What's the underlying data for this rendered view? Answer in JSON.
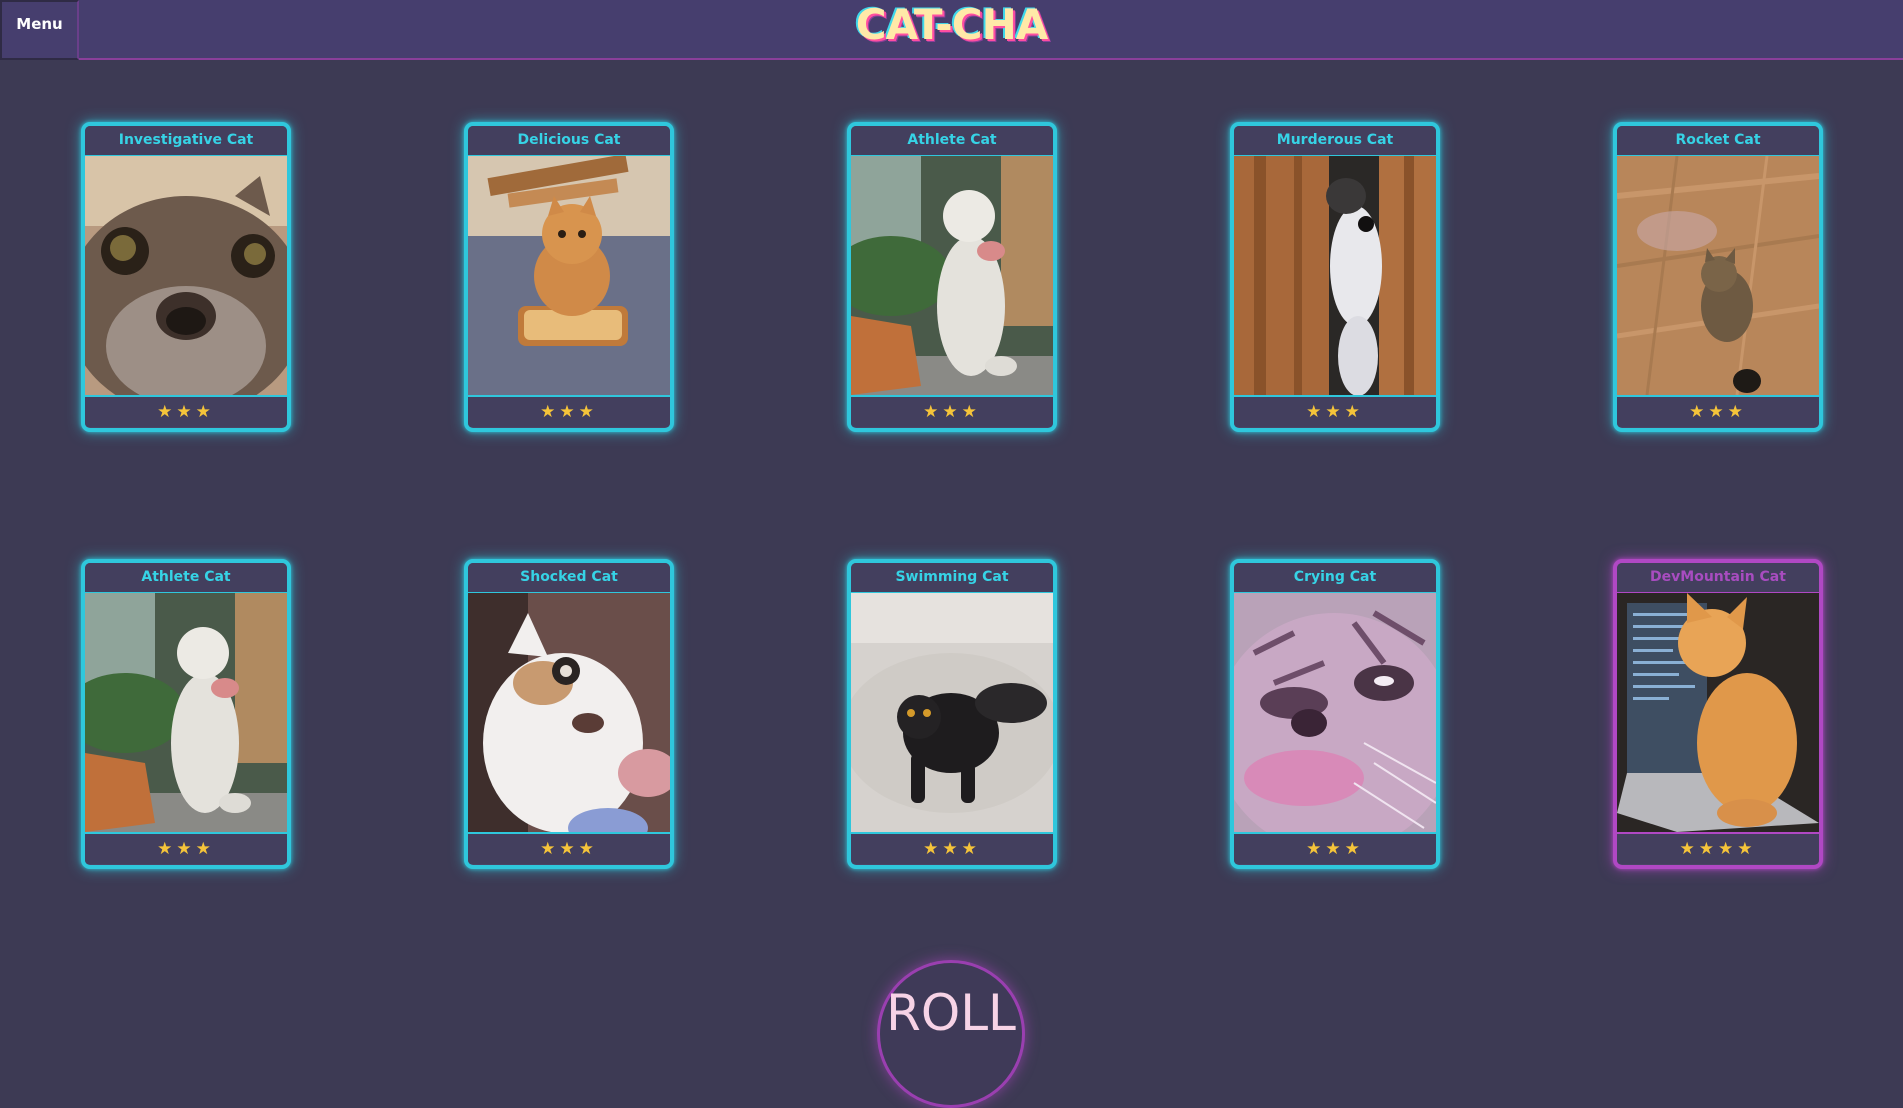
{
  "header": {
    "menu_label": "Menu",
    "logo_text": "CAT-CHA"
  },
  "cards": [
    {
      "title": "Investigative Cat",
      "stars": "★★★",
      "stars_count": 3,
      "rarity": "common",
      "image_icon": "cat-closeup-icon"
    },
    {
      "title": "Delicious Cat",
      "stars": "★★★",
      "stars_count": 3,
      "rarity": "common",
      "image_icon": "kitten-bread-icon"
    },
    {
      "title": "Athlete Cat",
      "stars": "★★★",
      "stars_count": 3,
      "rarity": "common",
      "image_icon": "standing-cat-icon"
    },
    {
      "title": "Murderous Cat",
      "stars": "★★★",
      "stars_count": 3,
      "rarity": "common",
      "image_icon": "peeking-cat-icon"
    },
    {
      "title": "Rocket Cat",
      "stars": "★★★",
      "stars_count": 3,
      "rarity": "common",
      "image_icon": "tabby-floor-icon"
    },
    {
      "title": "Athlete Cat",
      "stars": "★★★",
      "stars_count": 3,
      "rarity": "common",
      "image_icon": "standing-cat-icon"
    },
    {
      "title": "Shocked Cat",
      "stars": "★★★",
      "stars_count": 3,
      "rarity": "common",
      "image_icon": "shocked-cat-icon"
    },
    {
      "title": "Swimming Cat",
      "stars": "★★★",
      "stars_count": 3,
      "rarity": "common",
      "image_icon": "wet-cat-icon"
    },
    {
      "title": "Crying Cat",
      "stars": "★★★",
      "stars_count": 3,
      "rarity": "common",
      "image_icon": "crying-cat-icon"
    },
    {
      "title": "DevMountain Cat",
      "stars": "★★★★",
      "stars_count": 4,
      "rarity": "rare",
      "image_icon": "laptop-kitten-icon"
    }
  ],
  "roll": {
    "label": "ROLL"
  },
  "colors": {
    "background": "#3d3a54",
    "header": "#463e6e",
    "common_border": "#2fc7dc",
    "rare_border": "#b048c4",
    "star": "#f5c43a"
  }
}
